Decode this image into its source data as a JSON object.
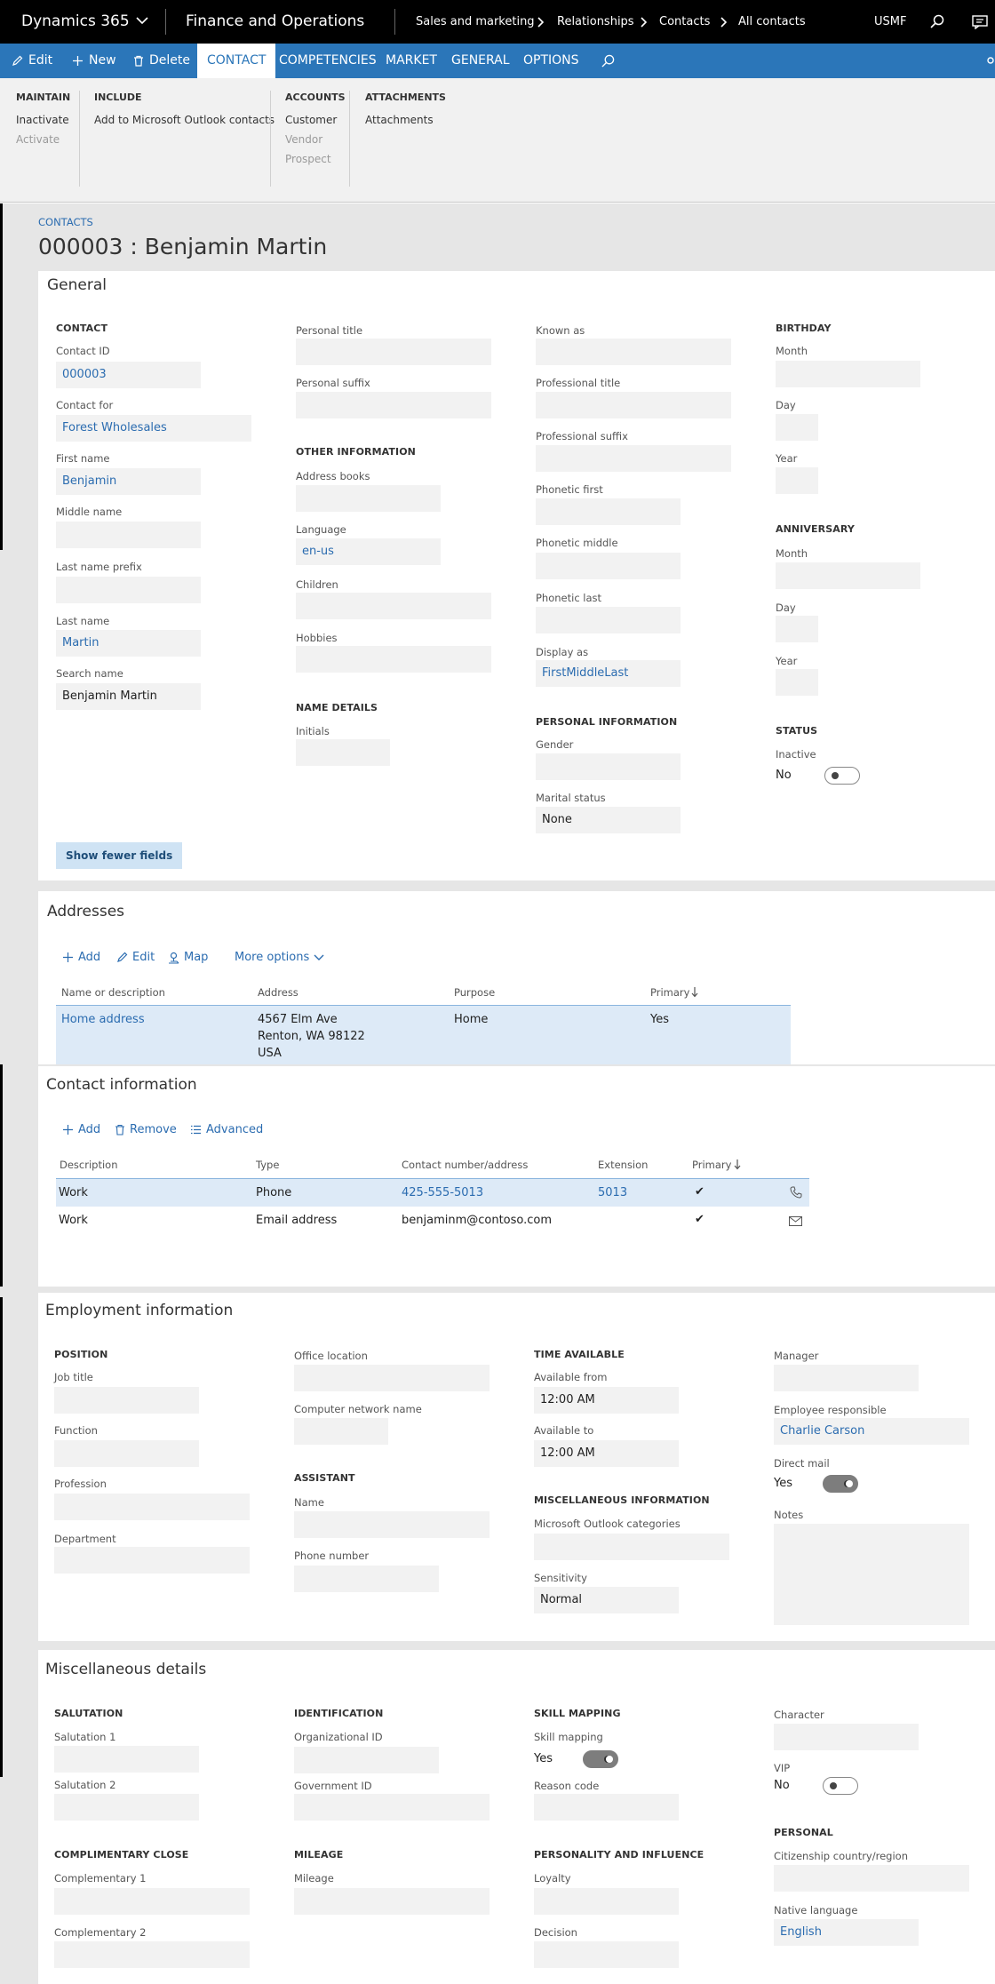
{
  "topbar": {
    "app": "Dynamics 365",
    "module": "Finance and Operations",
    "breadcrumb": [
      "Sales and marketing",
      "Relationships",
      "Contacts",
      "All contacts"
    ],
    "company": "USMF"
  },
  "actionbar": {
    "edit": "Edit",
    "new": "New",
    "delete": "Delete",
    "tabs": [
      "CONTACT",
      "COMPETENCIES",
      "MARKET",
      "GENERAL",
      "OPTIONS"
    ],
    "active_tab": "CONTACT"
  },
  "ribbon": {
    "maintain": {
      "title": "MAINTAIN",
      "items": [
        "Inactivate",
        "Activate"
      ]
    },
    "include": {
      "title": "INCLUDE",
      "items": [
        "Add to Microsoft Outlook contacts"
      ]
    },
    "accounts": {
      "title": "ACCOUNTS",
      "items": [
        "Customer",
        "Vendor",
        "Prospect"
      ]
    },
    "attachments": {
      "title": "ATTACHMENTS",
      "items": [
        "Attachments"
      ]
    }
  },
  "page": {
    "caption": "CONTACTS",
    "title": "000003 : Benjamin Martin"
  },
  "general": {
    "title": "General",
    "contact": {
      "title": "CONTACT",
      "contact_id_label": "Contact ID",
      "contact_id": "000003",
      "contact_for_label": "Contact for",
      "contact_for": "Forest Wholesales",
      "first_name_label": "First name",
      "first_name": "Benjamin",
      "middle_name_label": "Middle name",
      "middle_name": "",
      "last_name_prefix_label": "Last name prefix",
      "last_name_prefix": "",
      "last_name_label": "Last name",
      "last_name": "Martin",
      "search_name_label": "Search name",
      "search_name": "Benjamin Martin"
    },
    "col2": {
      "personal_title_label": "Personal title",
      "personal_title": "",
      "personal_suffix_label": "Personal suffix",
      "personal_suffix": "",
      "other_info_title": "OTHER INFORMATION",
      "address_books_label": "Address books",
      "address_books": "",
      "language_label": "Language",
      "language": "en-us",
      "children_label": "Children",
      "children": "",
      "hobbies_label": "Hobbies",
      "hobbies": "",
      "name_details_title": "NAME DETAILS",
      "initials_label": "Initials",
      "initials": ""
    },
    "col3": {
      "known_as_label": "Known as",
      "known_as": "",
      "professional_title_label": "Professional title",
      "professional_title": "",
      "professional_suffix_label": "Professional suffix",
      "professional_suffix": "",
      "phonetic_first_label": "Phonetic first",
      "phonetic_first": "",
      "phonetic_middle_label": "Phonetic middle",
      "phonetic_middle": "",
      "phonetic_last_label": "Phonetic last",
      "phonetic_last": "",
      "display_as_label": "Display as",
      "display_as": "FirstMiddleLast",
      "personal_info_title": "PERSONAL INFORMATION",
      "gender_label": "Gender",
      "gender": "",
      "marital_status_label": "Marital status",
      "marital_status": "None"
    },
    "col4": {
      "birthday_title": "BIRTHDAY",
      "month_label": "Month",
      "day_label": "Day",
      "year_label": "Year",
      "anniversary_title": "ANNIVERSARY",
      "status_title": "STATUS",
      "inactive_label": "Inactive",
      "inactive_value": "No"
    },
    "show_fewer": "Show fewer fields"
  },
  "addresses": {
    "title": "Addresses",
    "toolbar": {
      "add": "Add",
      "edit": "Edit",
      "map": "Map",
      "more": "More options"
    },
    "columns": [
      "Name or description",
      "Address",
      "Purpose",
      "Primary"
    ],
    "rows": [
      {
        "name": "Home address",
        "address_lines": [
          "4567 Elm Ave",
          "Renton, WA 98122",
          "USA"
        ],
        "purpose": "Home",
        "primary": "Yes"
      }
    ]
  },
  "contact_info": {
    "title": "Contact information",
    "toolbar": {
      "add": "Add",
      "remove": "Remove",
      "advanced": "Advanced"
    },
    "columns": [
      "Description",
      "Type",
      "Contact number/address",
      "Extension",
      "Primary"
    ],
    "rows": [
      {
        "description": "Work",
        "type": "Phone",
        "contact": "425-555-5013",
        "extension": "5013",
        "primary": "✔",
        "icon": "phone-icon"
      },
      {
        "description": "Work",
        "type": "Email address",
        "contact": "benjaminm@contoso.com",
        "extension": "",
        "primary": "✔",
        "icon": "mail-icon"
      }
    ]
  },
  "employment": {
    "title": "Employment information",
    "position_title": "POSITION",
    "job_title_label": "Job title",
    "function_label": "Function",
    "profession_label": "Profession",
    "department_label": "Department",
    "office_location_label": "Office location",
    "computer_network_label": "Computer network name",
    "assistant_title": "ASSISTANT",
    "name_label": "Name",
    "phone_label": "Phone number",
    "time_title": "TIME AVAILABLE",
    "available_from_label": "Available from",
    "available_from": "12:00 AM",
    "available_to_label": "Available to",
    "available_to": "12:00 AM",
    "misc_title": "MISCELLANEOUS INFORMATION",
    "outlook_categories_label": "Microsoft Outlook categories",
    "sensitivity_label": "Sensitivity",
    "sensitivity": "Normal",
    "manager_label": "Manager",
    "employee_responsible_label": "Employee responsible",
    "employee_responsible": "Charlie Carson",
    "direct_mail_label": "Direct mail",
    "direct_mail": "Yes",
    "notes_label": "Notes"
  },
  "misc": {
    "title": "Miscellaneous details",
    "salutation_title": "SALUTATION",
    "salutation1_label": "Salutation 1",
    "salutation2_label": "Salutation 2",
    "complimentary_title": "COMPLIMENTARY CLOSE",
    "complementary1_label": "Complementary 1",
    "complementary2_label": "Complementary 2",
    "identification_title": "IDENTIFICATION",
    "org_id_label": "Organizational ID",
    "gov_id_label": "Government ID",
    "mileage_title": "MILEAGE",
    "mileage_label": "Mileage",
    "skill_title": "SKILL MAPPING",
    "skill_label": "Skill mapping",
    "skill_value": "Yes",
    "reason_label": "Reason code",
    "personality_title": "PERSONALITY AND INFLUENCE",
    "loyalty_label": "Loyalty",
    "decision_label": "Decision",
    "character_label": "Character",
    "vip_label": "VIP",
    "vip_value": "No",
    "personal_title": "PERSONAL",
    "citizenship_label": "Citizenship country/region",
    "native_language_label": "Native language",
    "native_language": "English"
  }
}
